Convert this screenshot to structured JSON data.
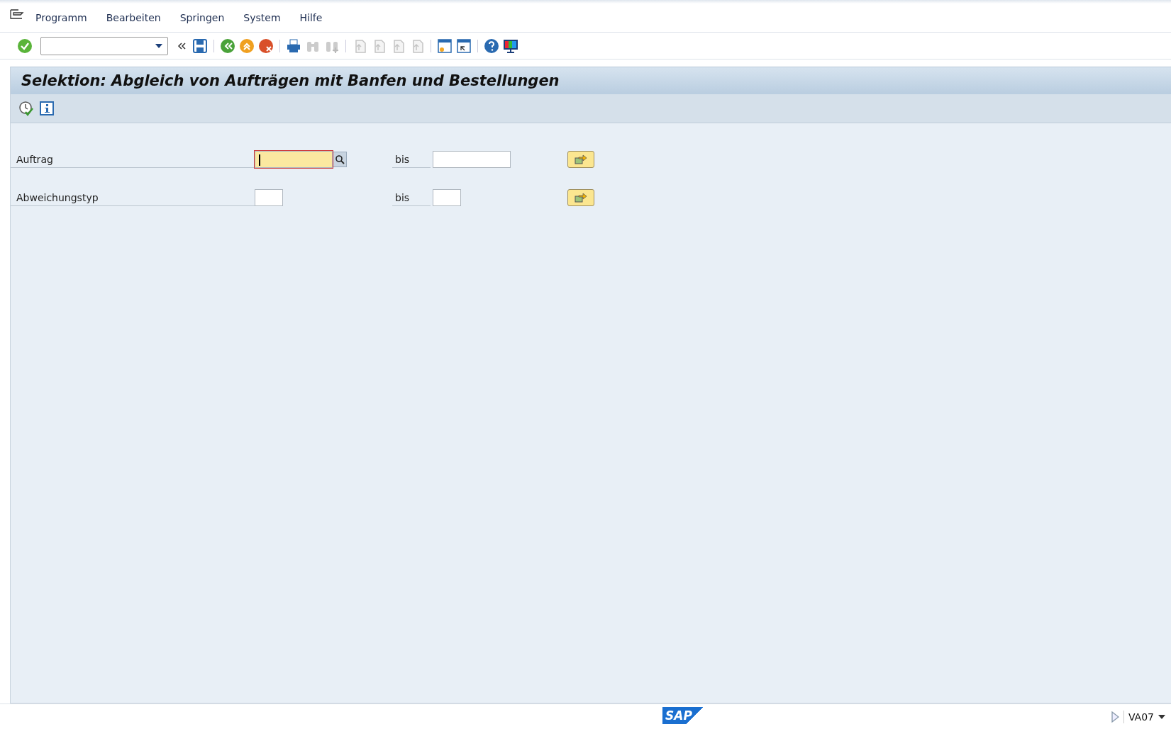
{
  "menu": [
    {
      "label": "Programm"
    },
    {
      "label": "Bearbeiten"
    },
    {
      "label": "Springen"
    },
    {
      "label": "System"
    },
    {
      "label": "Hilfe"
    }
  ],
  "title": "Selektion: Abgleich von Aufträgen mit Banfen und Bestellungen",
  "rows": [
    {
      "label": "Auftrag",
      "focused": true,
      "has_search": true,
      "to_label": "bis",
      "wide": true
    },
    {
      "label": "Abweichungstyp",
      "focused": false,
      "has_search": false,
      "to_label": "bis",
      "wide": false
    }
  ],
  "status_bar": {
    "logo": "SAP",
    "transaction": "VA07"
  }
}
